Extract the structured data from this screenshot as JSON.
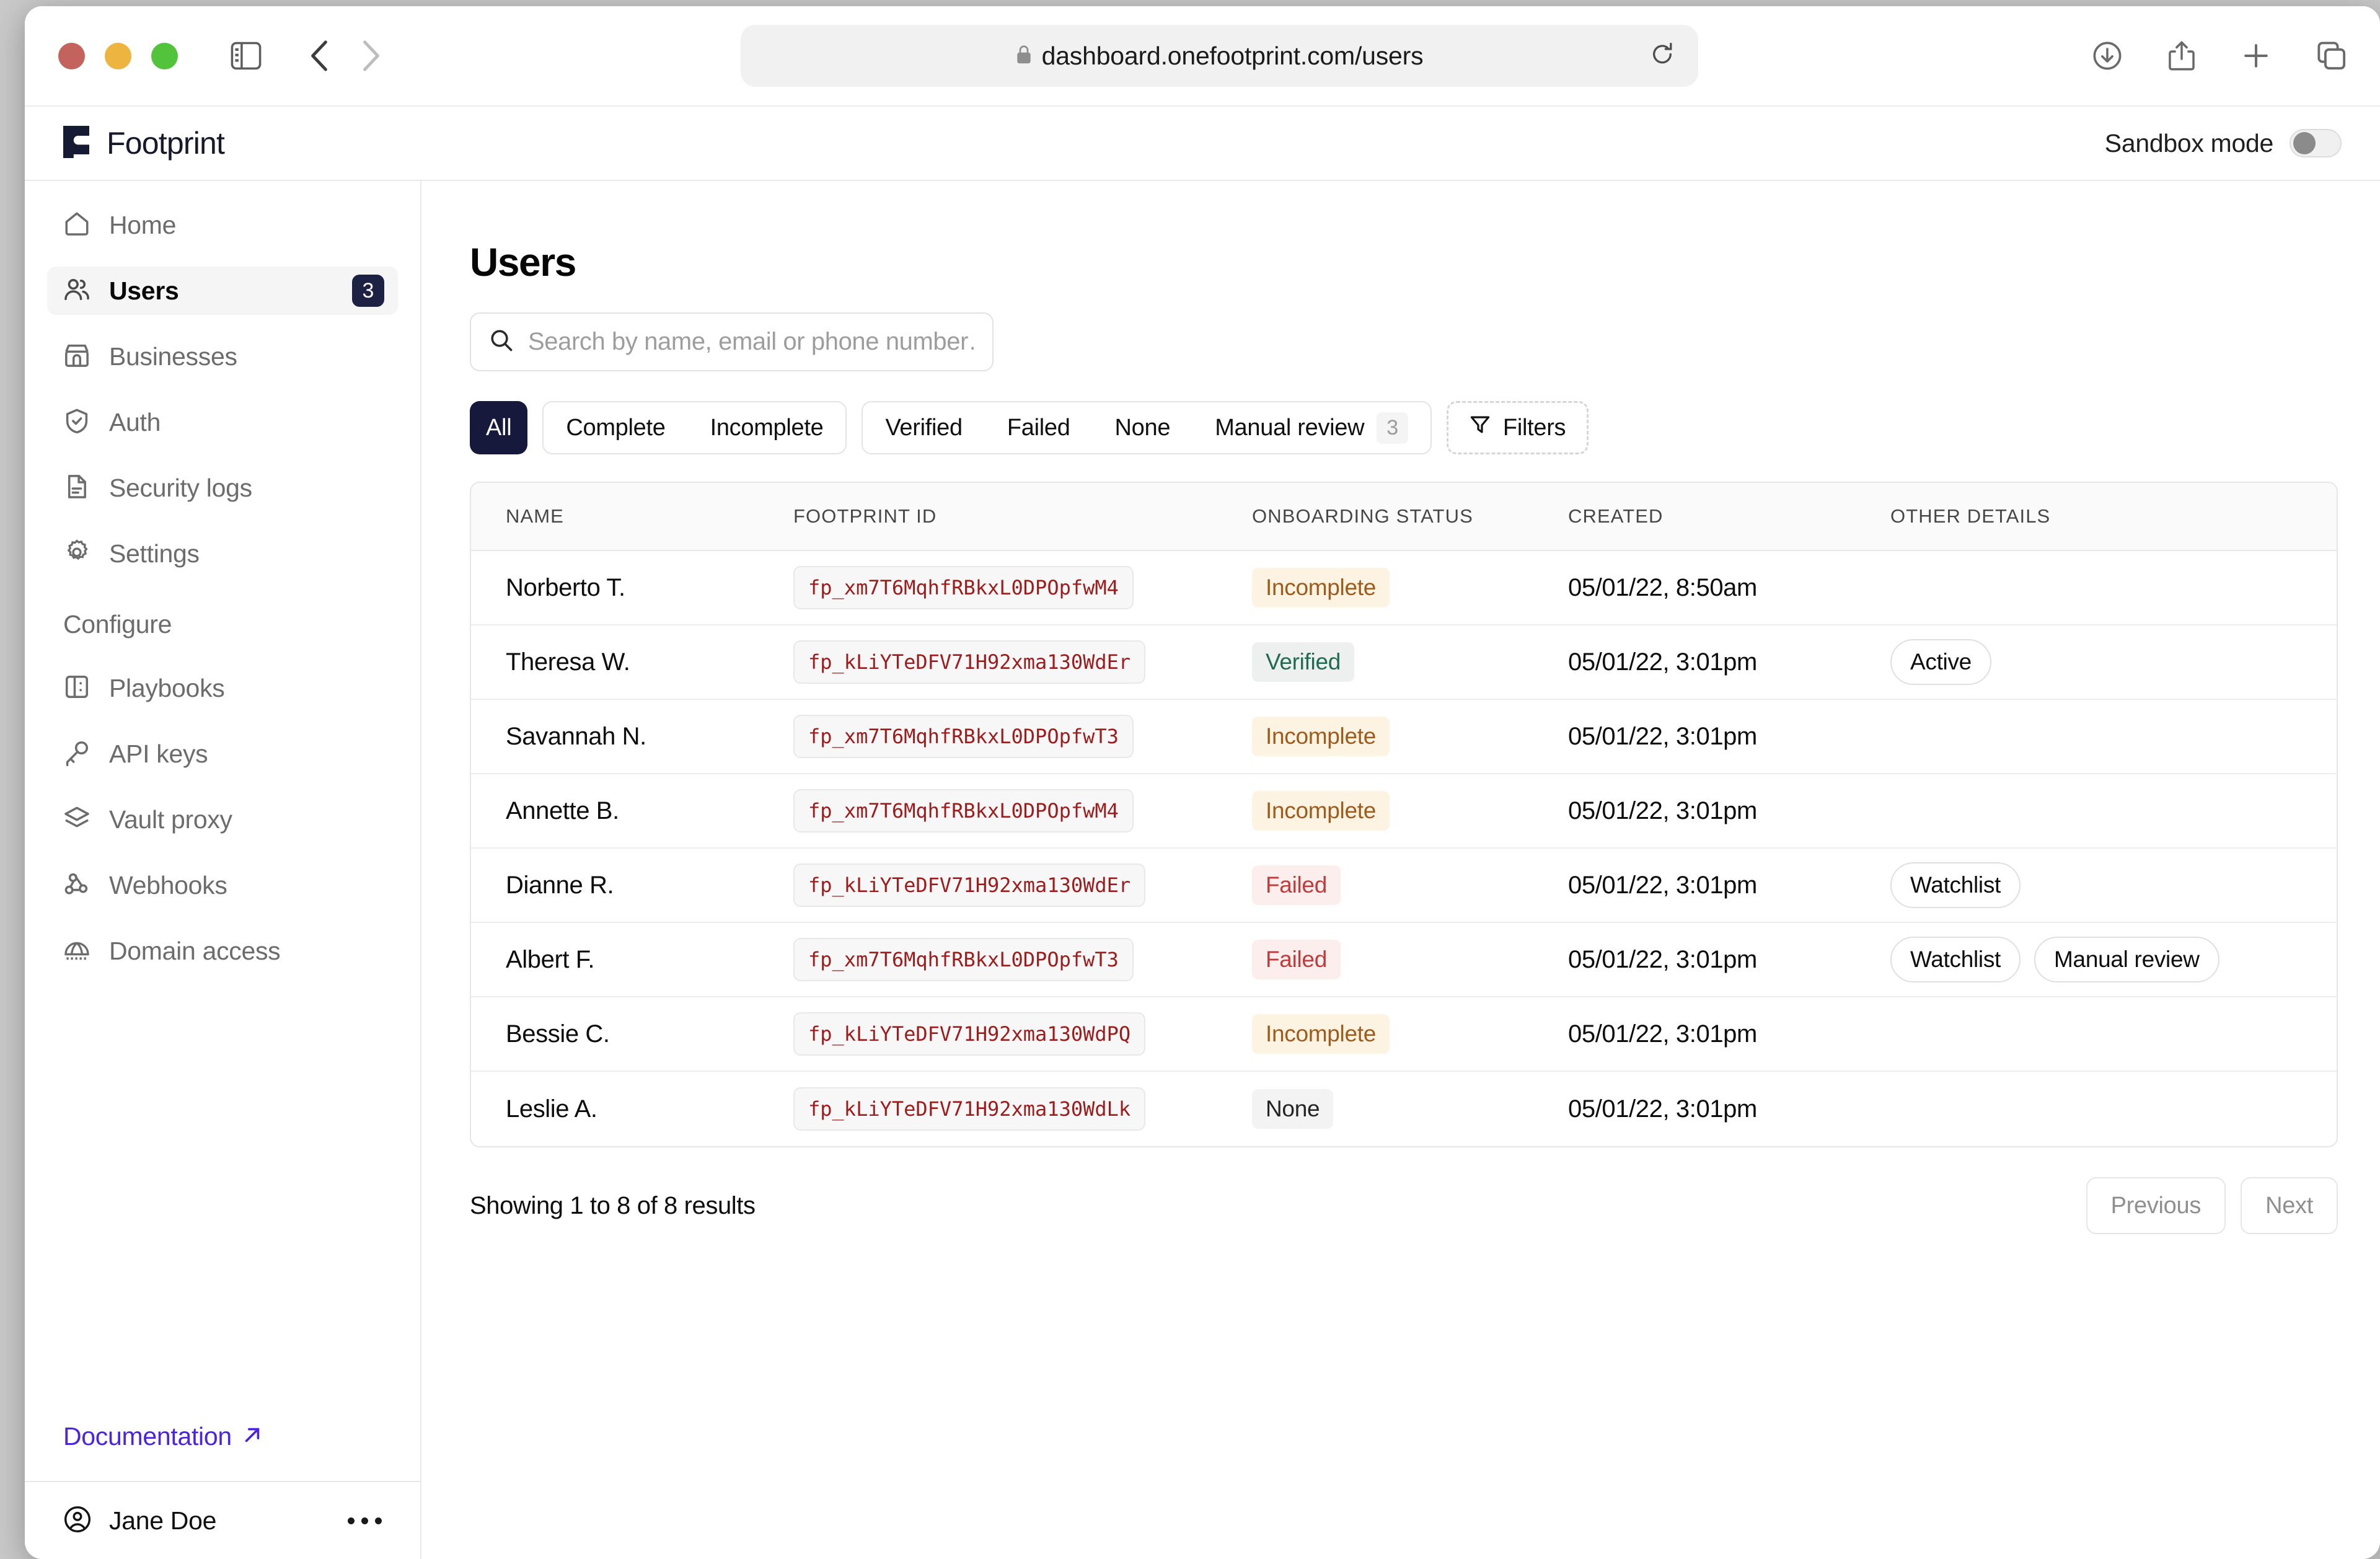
{
  "browser": {
    "url": "dashboard.onefootprint.com/users",
    "lock_icon": "lock-icon",
    "traffic_lights": [
      "close",
      "minimize",
      "zoom"
    ],
    "toolbar_icons": [
      "sidebar-toggle-icon",
      "back-icon",
      "forward-icon",
      "shield-icon",
      "reload-icon",
      "downloads-icon",
      "share-icon",
      "new-tab-icon",
      "tab-overview-icon"
    ]
  },
  "app_header": {
    "brand": "Footprint",
    "sandbox_label": "Sandbox mode",
    "sandbox_on": false
  },
  "sidebar": {
    "items": [
      {
        "label": "Home",
        "icon": "home-icon",
        "active": false,
        "badge": ""
      },
      {
        "label": "Users",
        "icon": "users-icon",
        "active": true,
        "badge": "3"
      },
      {
        "label": "Businesses",
        "icon": "store-icon",
        "active": false,
        "badge": ""
      },
      {
        "label": "Auth",
        "icon": "shield-check-icon",
        "active": false,
        "badge": ""
      },
      {
        "label": "Security logs",
        "icon": "document-icon",
        "active": false,
        "badge": ""
      },
      {
        "label": "Settings",
        "icon": "gear-icon",
        "active": false,
        "badge": ""
      }
    ],
    "section_title": "Configure",
    "configure_items": [
      {
        "label": "Playbooks",
        "icon": "book-icon"
      },
      {
        "label": "API keys",
        "icon": "key-icon"
      },
      {
        "label": "Vault proxy",
        "icon": "layers-icon"
      },
      {
        "label": "Webhooks",
        "icon": "webhook-icon"
      },
      {
        "label": "Domain access",
        "icon": "globe-icon"
      }
    ],
    "documentation_label": "Documentation",
    "documentation_icon": "external-link-icon",
    "user": {
      "name": "Jane Doe",
      "avatar_icon": "user-circle-icon",
      "menu_icon": "ellipsis-icon"
    }
  },
  "main": {
    "title": "Users",
    "search": {
      "placeholder": "Search by name, email or phone number…",
      "value": "",
      "icon": "search-icon"
    },
    "filters": {
      "all_label": "All",
      "group_one": [
        "Complete",
        "Incomplete"
      ],
      "group_two": [
        {
          "label": "Verified",
          "count": ""
        },
        {
          "label": "Failed",
          "count": ""
        },
        {
          "label": "None",
          "count": ""
        },
        {
          "label": "Manual review",
          "count": "3"
        }
      ],
      "filters_button": {
        "label": "Filters",
        "icon": "funnel-icon"
      }
    },
    "table": {
      "columns": [
        "Name",
        "Footprint ID",
        "Onboarding status",
        "Created",
        "Other details"
      ],
      "rows": [
        {
          "name": "Norberto T.",
          "fpid": "fp_xm7T6MqhfRBkxL0DPOpfwM4",
          "status": "Incomplete",
          "status_kind": "incomplete",
          "created": "05/01/22, 8:50am",
          "other": []
        },
        {
          "name": "Theresa W.",
          "fpid": "fp_kLiYTeDFV71H92xma130WdEr",
          "status": "Verified",
          "status_kind": "verified",
          "created": "05/01/22, 3:01pm",
          "other": [
            "Active"
          ]
        },
        {
          "name": "Savannah N.",
          "fpid": "fp_xm7T6MqhfRBkxL0DPOpfwT3",
          "status": "Incomplete",
          "status_kind": "incomplete",
          "created": "05/01/22, 3:01pm",
          "other": []
        },
        {
          "name": "Annette B.",
          "fpid": "fp_xm7T6MqhfRBkxL0DPOpfwM4",
          "status": "Incomplete",
          "status_kind": "incomplete",
          "created": "05/01/22, 3:01pm",
          "other": []
        },
        {
          "name": "Dianne R.",
          "fpid": "fp_kLiYTeDFV71H92xma130WdEr",
          "status": "Failed",
          "status_kind": "failed",
          "created": "05/01/22, 3:01pm",
          "other": [
            "Watchlist"
          ]
        },
        {
          "name": "Albert F.",
          "fpid": "fp_xm7T6MqhfRBkxL0DPOpfwT3",
          "status": "Failed",
          "status_kind": "failed",
          "created": "05/01/22, 3:01pm",
          "other": [
            "Watchlist",
            "Manual review"
          ]
        },
        {
          "name": "Bessie C.",
          "fpid": "fp_kLiYTeDFV71H92xma130WdPQ",
          "status": "Incomplete",
          "status_kind": "incomplete",
          "created": "05/01/22, 3:01pm",
          "other": []
        },
        {
          "name": "Leslie A.",
          "fpid": "fp_kLiYTeDFV71H92xma130WdLk",
          "status": "None",
          "status_kind": "none",
          "created": "05/01/22, 3:01pm",
          "other": []
        }
      ]
    },
    "pagination": {
      "showing": "Showing 1 to 8 of 8 results",
      "previous": "Previous",
      "next": "Next"
    }
  },
  "colors": {
    "brand_navy": "#16193b",
    "accent_purple": "#4a24e0",
    "fpid_red": "#9e1b1b",
    "status_incomplete": "#a05b1b",
    "status_verified": "#1f6b4f",
    "status_failed": "#c13b3b"
  }
}
